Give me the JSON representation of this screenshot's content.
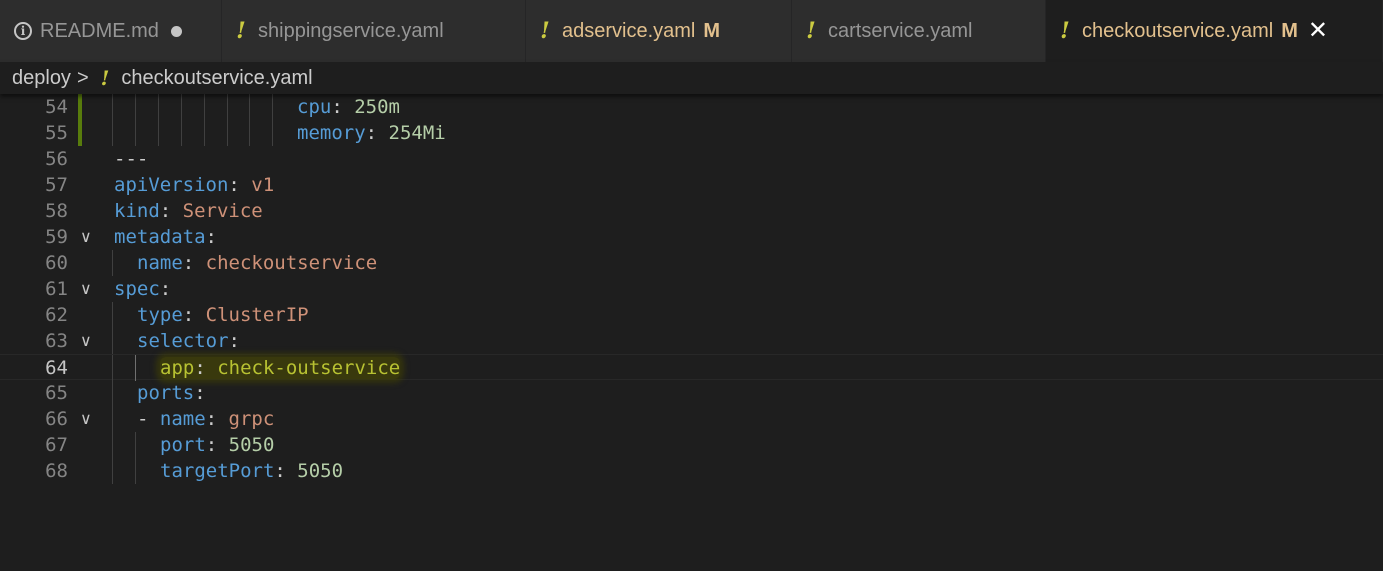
{
  "tabs": [
    {
      "label": "README.md",
      "icon": "info-icon",
      "dirty": true,
      "modified": false,
      "active": false
    },
    {
      "label": "shippingservice.yaml",
      "icon": "yaml-icon",
      "dirty": false,
      "modified": false,
      "active": false
    },
    {
      "label": "adservice.yaml",
      "icon": "yaml-icon",
      "dirty": false,
      "modified": true,
      "badge": "M",
      "active": false
    },
    {
      "label": "cartservice.yaml",
      "icon": "yaml-icon",
      "dirty": false,
      "modified": false,
      "active": false
    },
    {
      "label": "checkoutservice.yaml",
      "icon": "yaml-icon",
      "dirty": false,
      "modified": true,
      "badge": "M",
      "active": true
    }
  ],
  "tab_icon_glyphs": {
    "yaml": "!",
    "info": "i",
    "close": "✕"
  },
  "breadcrumb": {
    "folder": "deploy",
    "separator": ">",
    "file": "checkoutservice.yaml"
  },
  "editor": {
    "current_line": "64",
    "highlighted_text": "app: check-outservice",
    "lines": [
      {
        "num": "54",
        "key": "cpu",
        "colon": ":",
        "value": "250m",
        "vtype": "number"
      },
      {
        "num": "55",
        "key": "memory",
        "colon": ":",
        "value": "254Mi",
        "vtype": "number"
      },
      {
        "num": "56",
        "key": "",
        "colon": "",
        "value": "---",
        "vtype": "doc"
      },
      {
        "num": "57",
        "key": "apiVersion",
        "colon": ":",
        "value": "v1",
        "vtype": "string"
      },
      {
        "num": "58",
        "key": "kind",
        "colon": ":",
        "value": "Service",
        "vtype": "string"
      },
      {
        "num": "59",
        "key": "metadata",
        "colon": ":",
        "value": "",
        "vtype": "none"
      },
      {
        "num": "60",
        "key": "name",
        "colon": ":",
        "value": "checkoutservice",
        "vtype": "string"
      },
      {
        "num": "61",
        "key": "spec",
        "colon": ":",
        "value": "",
        "vtype": "none"
      },
      {
        "num": "62",
        "key": "type",
        "colon": ":",
        "value": "ClusterIP",
        "vtype": "string"
      },
      {
        "num": "63",
        "key": "selector",
        "colon": ":",
        "value": "",
        "vtype": "none"
      },
      {
        "num": "64",
        "key": "app",
        "colon": ":",
        "value": "check-outservice",
        "vtype": "string"
      },
      {
        "num": "65",
        "key": "ports",
        "colon": ":",
        "value": "",
        "vtype": "none"
      },
      {
        "num": "66",
        "dash": "- ",
        "key": "name",
        "colon": ":",
        "value": "grpc",
        "vtype": "string"
      },
      {
        "num": "67",
        "key": "port",
        "colon": ":",
        "value": "5050",
        "vtype": "number"
      },
      {
        "num": "68",
        "key": "targetPort",
        "colon": ":",
        "value": "5050",
        "vtype": "number"
      }
    ]
  },
  "colors": {
    "background": "#1e1e1e",
    "key": "#569cd6",
    "string": "#ce9178",
    "number": "#b5cea8",
    "modified": "#e2c08d",
    "yaml_icon": "#cbcb41",
    "gutter_modified": "#587c0c"
  }
}
